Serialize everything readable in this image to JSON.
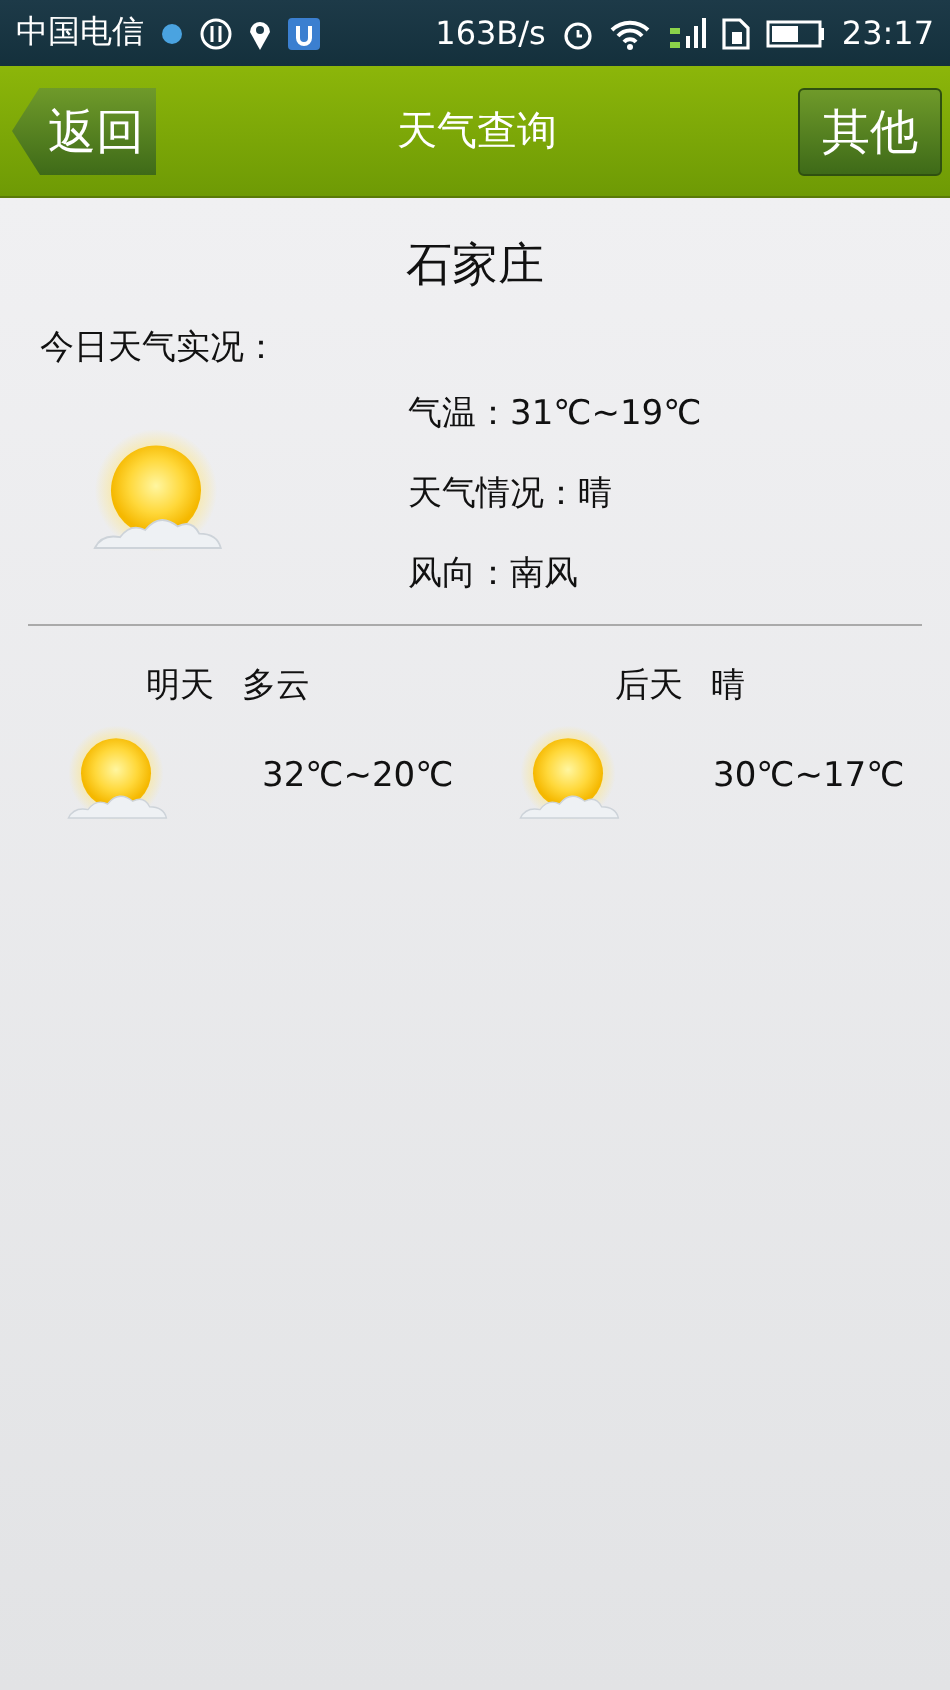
{
  "status_bar": {
    "carrier": "中国电信",
    "speed": "163B/s",
    "time": "23:17"
  },
  "header": {
    "back": "返回",
    "title": "天气查询",
    "other": "其他"
  },
  "city": "石家庄",
  "today": {
    "label": "今日天气实况：",
    "details": [
      {
        "text": "气温：31℃~19℃"
      },
      {
        "text": "天气情况：晴"
      },
      {
        "text": "风向：南风"
      }
    ]
  },
  "forecast": [
    {
      "day": "明天",
      "condition": "多云",
      "temps": "32℃~20℃"
    },
    {
      "day": "后天",
      "condition": "晴",
      "temps": "30℃~17℃"
    }
  ]
}
